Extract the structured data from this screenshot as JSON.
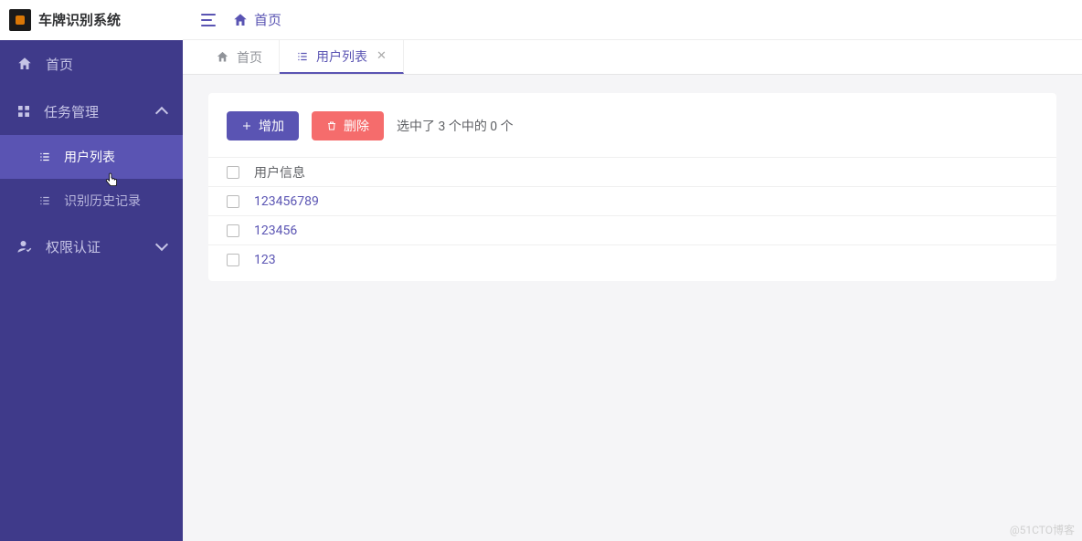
{
  "app": {
    "title": "车牌识别系统"
  },
  "header": {
    "home_label": "首页"
  },
  "sidebar": {
    "home": "首页",
    "group_tasks": "任务管理",
    "sub_users": "用户列表",
    "sub_history": "识别历史记录",
    "group_auth": "权限认证"
  },
  "tabs": {
    "home": "首页",
    "users": "用户列表"
  },
  "toolbar": {
    "add_label": "增加",
    "delete_label": "删除",
    "selection_info": "选中了 3 个中的 0 个"
  },
  "table": {
    "header": "用户信息",
    "rows": [
      "123456789",
      "123456",
      "123"
    ]
  },
  "watermark": "@51CTO博客"
}
